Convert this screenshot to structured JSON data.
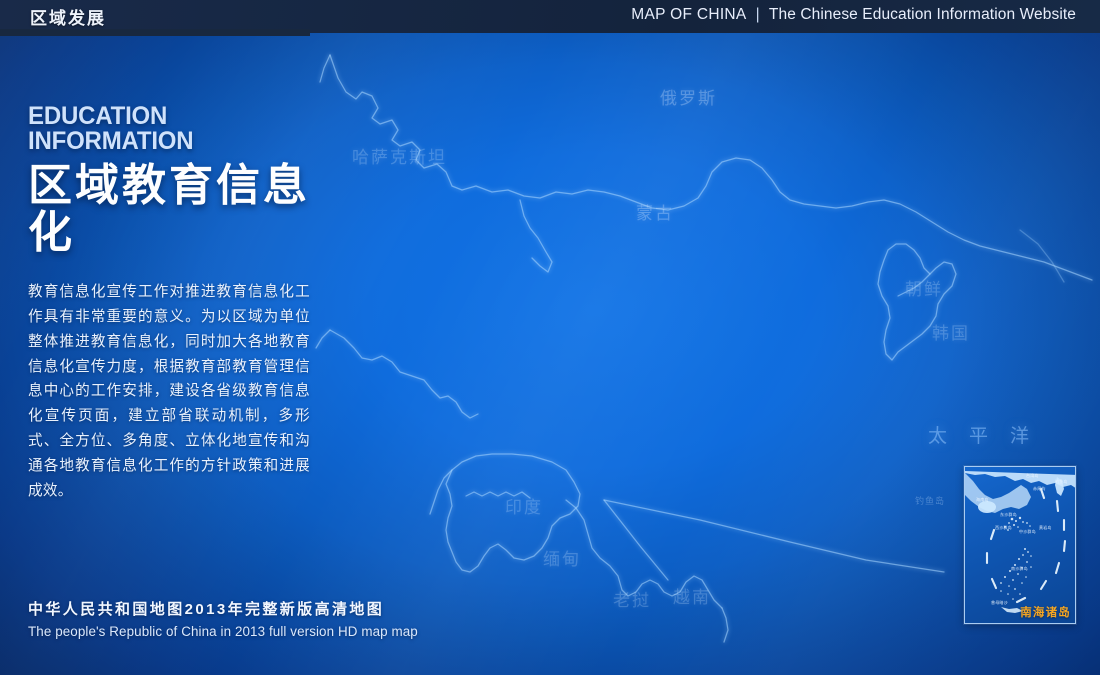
{
  "header": {
    "brand": "区域发展",
    "en_title": "MAP OF CHINA",
    "separator": "|",
    "site_name": "The Chinese Education Information Website"
  },
  "panel": {
    "eyebrow": "EDUCATION INFORMATION",
    "title": "区域教育信息化",
    "body": "教育信息化宣传工作对推进教育信息化工作具有非常重要的意义。为以区域为单位整体推进教育信息化，同时加大各地教育信息化宣传力度，根据教育部教育管理信息中心的工作安排，建设各省级教育信息化宣传页面，建立部省联动机制，多形式、全方位、多角度、立体化地宣传和沟通各地教育信息化工作的方针政策和进展成效。"
  },
  "caption": {
    "cn": "中华人民共和国地图2013年完整新版高清地图",
    "en": "The people's Republic of China in 2013 full version HD map map"
  },
  "map_labels": {
    "russia": "俄罗斯",
    "kazakhstan": "哈萨克斯坦",
    "mongolia": "蒙古",
    "north_korea": "朝鲜",
    "south_korea": "韩国",
    "pacific_ocean": "太平洋",
    "india": "印度",
    "myanmar": "缅甸",
    "laos": "老挝",
    "vietnam": "越南",
    "diaoyu": "钓鱼岛"
  },
  "inset": {
    "title": "南海诸岛",
    "labels": [
      "台湾岛",
      "钓鱼岛",
      "赤尾屿",
      "海南岛",
      "东沙群岛",
      "西沙群岛",
      "中沙群岛",
      "黄岩岛",
      "南沙群岛",
      "曾母暗沙"
    ]
  },
  "colors": {
    "accent_orange": "#f5a623",
    "header_dark": "#16273f",
    "map_blue_center": "#1274e6",
    "map_blue_edge": "#072f76",
    "text_light": "#eef3fb"
  }
}
